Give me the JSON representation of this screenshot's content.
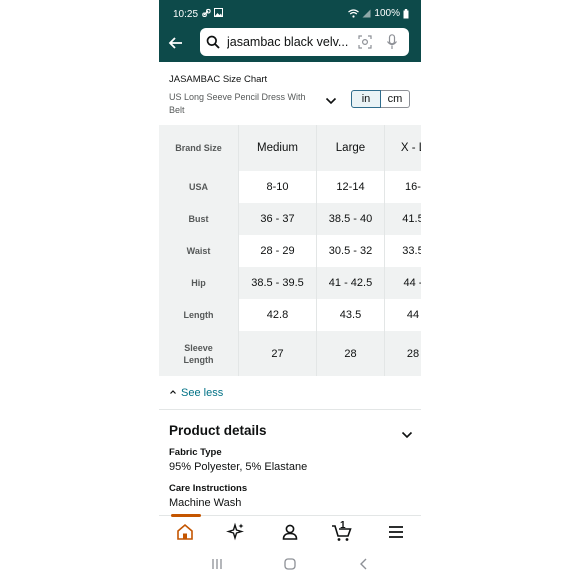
{
  "status": {
    "time": "10:25",
    "battery": "100%"
  },
  "search": {
    "query": "jasambac black velv..."
  },
  "size_chart": {
    "title": "JASAMBAC Size Chart",
    "subtitle": "US Long Seeve Pencil Dress With Belt",
    "units": {
      "in": "in",
      "cm": "cm"
    },
    "header": [
      "Brand Size",
      "Medium",
      "Large",
      "X - L"
    ],
    "rows": [
      [
        "USA",
        "8-10",
        "12-14",
        "16-"
      ],
      [
        "Bust",
        "36 - 37",
        "38.5 - 40",
        "41.5"
      ],
      [
        "Waist",
        "28 - 29",
        "30.5 - 32",
        "33.5"
      ],
      [
        "Hip",
        "38.5 - 39.5",
        "41 - 42.5",
        "44 -"
      ],
      [
        "Length",
        "42.8",
        "43.5",
        "44"
      ],
      [
        "Sleeve Length",
        "27",
        "28",
        "28"
      ]
    ],
    "see_less": "See less"
  },
  "product_details": {
    "title": "Product details",
    "fabric_label": "Fabric Type",
    "fabric_value": "95% Polyester, 5% Elastane",
    "care_label": "Care Instructions",
    "care_value": "Machine Wash"
  },
  "tabbar": {
    "cart_count": "1"
  },
  "colors": {
    "header_bg": "#0d4a4a",
    "accent": "#c45500",
    "link": "#007185"
  }
}
